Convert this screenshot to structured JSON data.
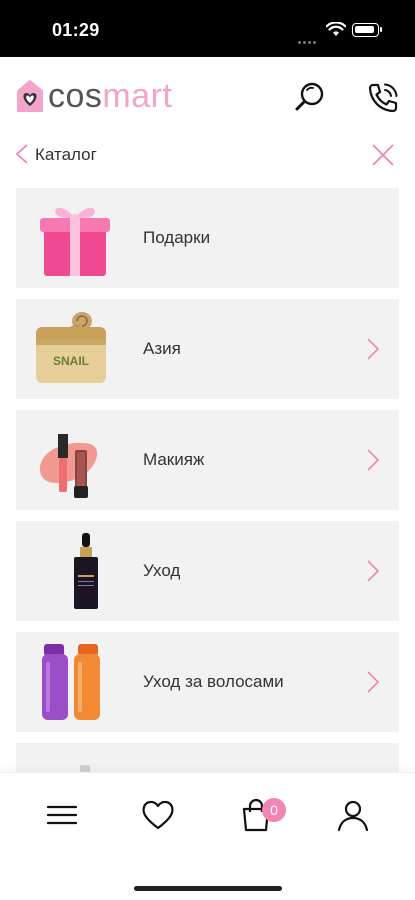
{
  "status_bar": {
    "time": "01:29"
  },
  "header": {
    "logo_cos": "cos",
    "logo_mart": "mart",
    "brand_color": "#f1a5c8"
  },
  "breadcrumb": {
    "label": "Каталог"
  },
  "catalog": {
    "items": [
      {
        "label": "Подарки",
        "has_chevron": false,
        "icon": "gift-box-image"
      },
      {
        "label": "Азия",
        "has_chevron": true,
        "icon": "snail-cream-jar-image",
        "jar_text": "SNAIL"
      },
      {
        "label": "Макияж",
        "has_chevron": true,
        "icon": "lip-gloss-image"
      },
      {
        "label": "Уход",
        "has_chevron": true,
        "icon": "serum-bottle-image"
      },
      {
        "label": "Уход за волосами",
        "has_chevron": true,
        "icon": "shampoo-bottles-image"
      }
    ]
  },
  "tabbar": {
    "cart_count": "0",
    "accent": "#f186b6"
  }
}
